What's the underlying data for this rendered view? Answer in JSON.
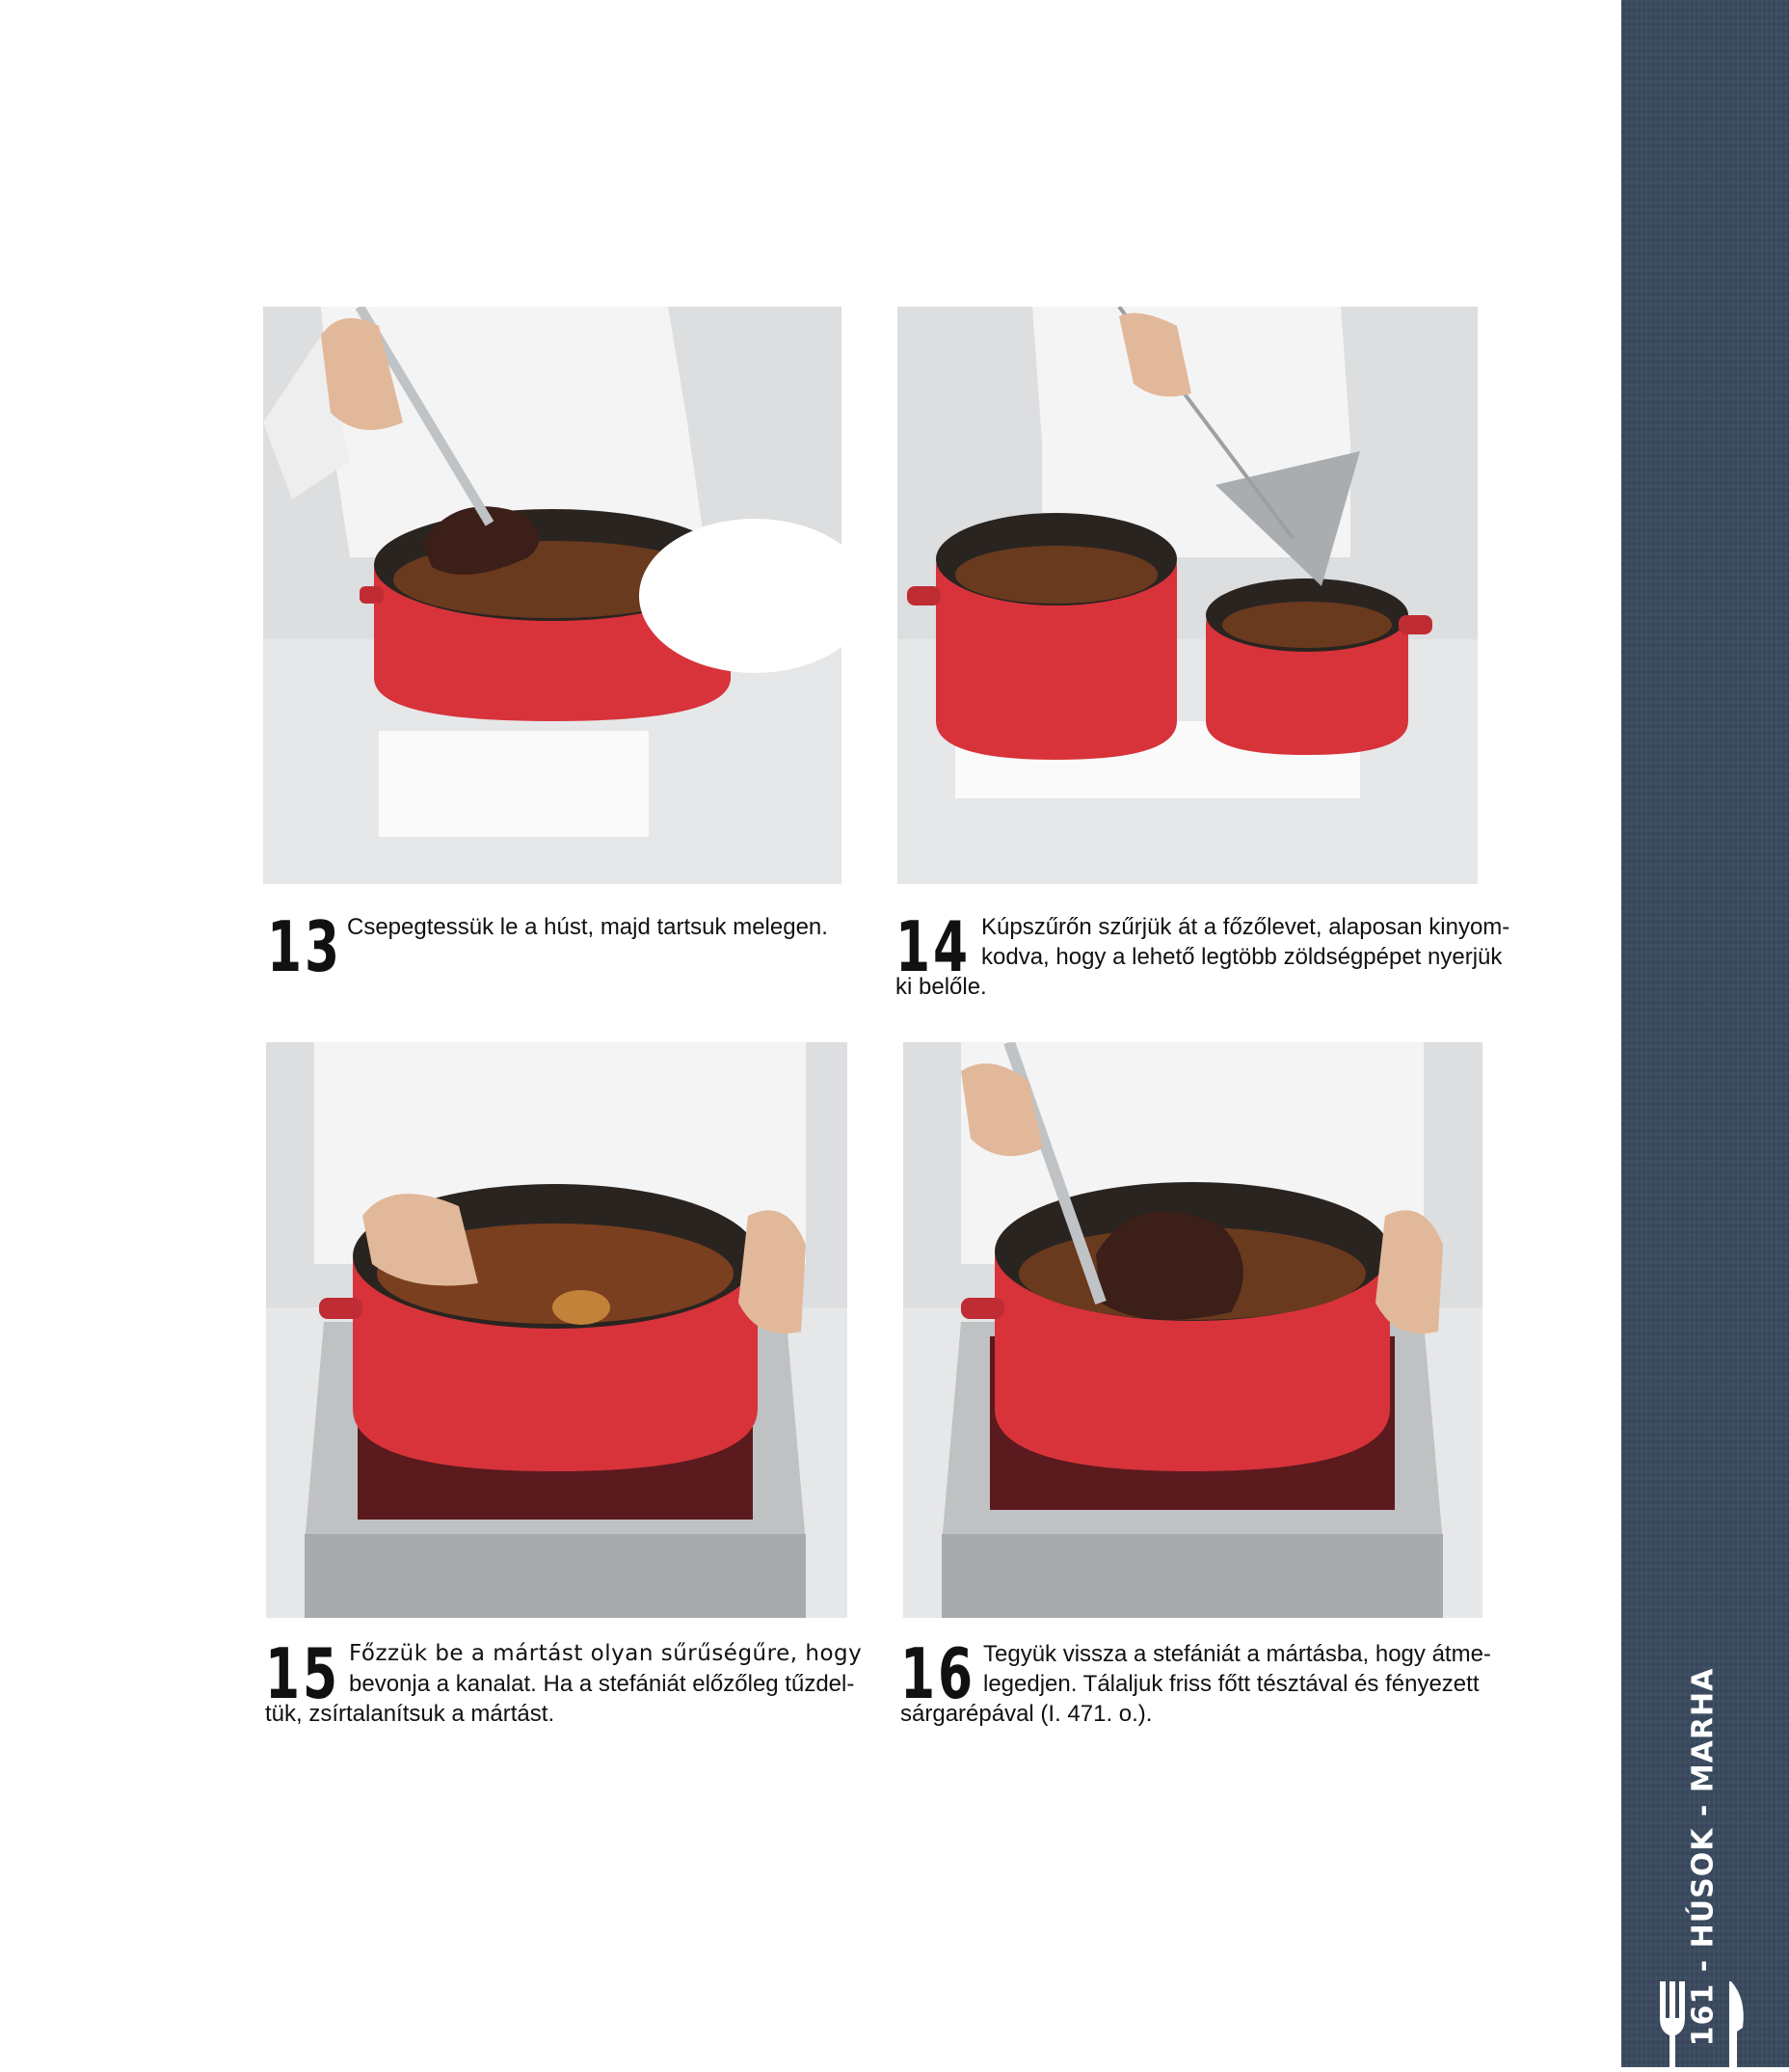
{
  "steps": [
    {
      "number": "13",
      "text": "Csepegtessük le a húst, majd tartsuk melegen."
    },
    {
      "number": "14",
      "text_line1": "Kúpszűrőn szűrjük át a főzőlevet, alaposan kinyom-",
      "text_line2": "kodva, hogy a lehető legtöbb zöldségpépet nyerjük",
      "text_line3": "ki belőle."
    },
    {
      "number": "15",
      "text_line1": "Főzzük be a mártást olyan sűrűségűre, hogy",
      "text_line2": "bevonja a kanalat. Ha a stefániát előzőleg tűzdel-",
      "text_line3": "tük, zsírtalanítsuk a mártást."
    },
    {
      "number": "16",
      "text_line1": "Tegyük vissza a stefániát a mártásba, hogy átme-",
      "text_line2": "legedjen. Tálaljuk friss főtt tésztával és fényezett",
      "text_line3": "sárgarépával (I. 471. o.)."
    }
  ],
  "side_label": "161 - HÚSOK - MARHA",
  "icons": [
    "cutlery-icon"
  ],
  "colors": {
    "side_band": "#3a4a5f",
    "pot_red": "#d8333a"
  }
}
